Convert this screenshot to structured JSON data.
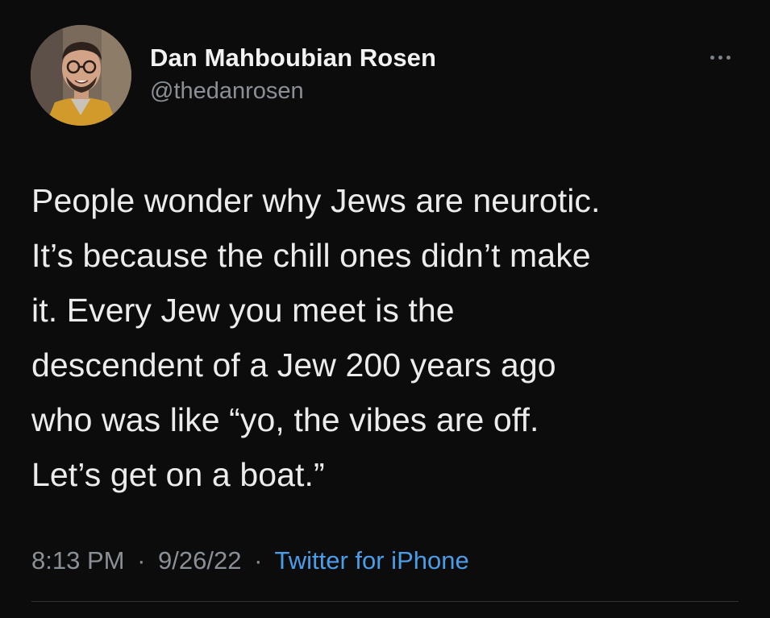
{
  "author": {
    "display_name": "Dan Mahboubian Rosen",
    "handle": "@thedanrosen"
  },
  "more_icon": "more-horizontal-icon",
  "tweet": {
    "text": "People wonder why Jews are neurotic.\nIt’s because the chill ones didn’t make\nit. Every Jew you meet is the\ndescendent of a Jew 200 years ago\nwho was like “yo, the vibes are off.\nLet’s get on a boat.”"
  },
  "meta": {
    "time": "8:13 PM",
    "date": "9/26/22",
    "separator": "·",
    "source": "Twitter for iPhone"
  },
  "colors": {
    "background": "#0c0c0c",
    "text": "#ececec",
    "secondary": "#8b9096",
    "accent": "#4a9de8"
  }
}
